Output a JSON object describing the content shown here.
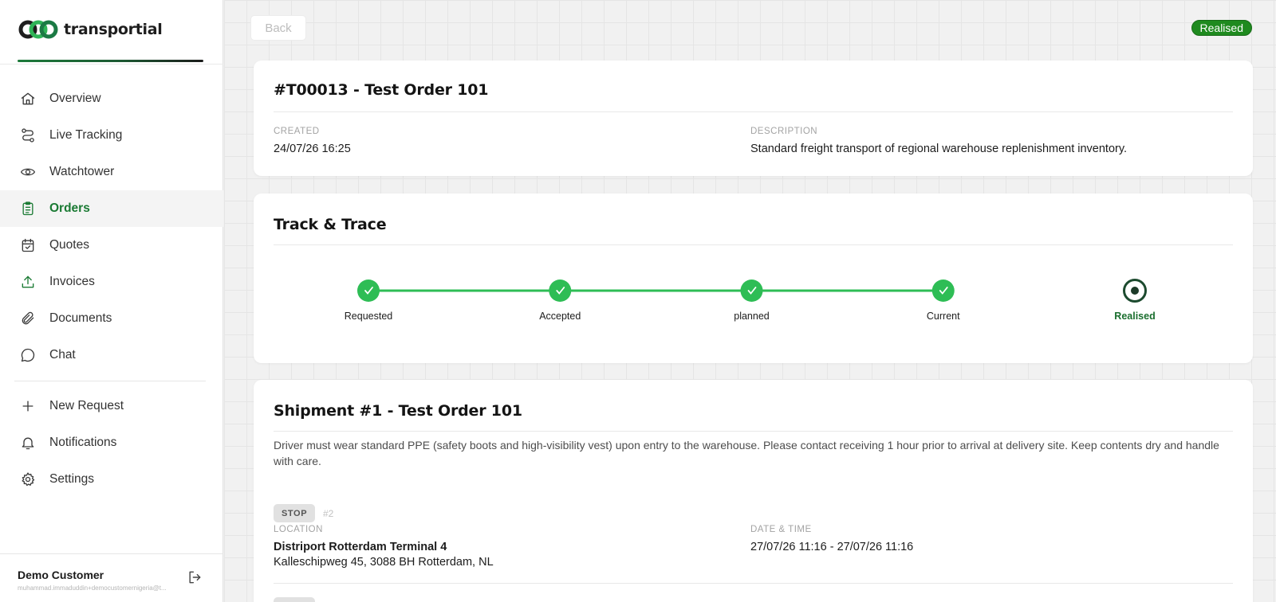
{
  "app": {
    "name": "transportial"
  },
  "sidebar": {
    "items": [
      {
        "label": "Overview",
        "icon": "home-icon"
      },
      {
        "label": "Live Tracking",
        "icon": "route-icon"
      },
      {
        "label": "Watchtower",
        "icon": "eye-icon"
      },
      {
        "label": "Orders",
        "icon": "clipboard-icon",
        "active": true
      },
      {
        "label": "Quotes",
        "icon": "calendar-check-icon"
      },
      {
        "label": "Invoices",
        "icon": "upload-icon"
      },
      {
        "label": "Documents",
        "icon": "paperclip-icon"
      },
      {
        "label": "Chat",
        "icon": "chat-bubble-icon"
      }
    ],
    "secondary": [
      {
        "label": "New Request",
        "icon": "plus-icon"
      },
      {
        "label": "Notifications",
        "icon": "bell-icon"
      },
      {
        "label": "Settings",
        "icon": "gear-icon"
      }
    ],
    "user": {
      "name": "Demo Customer",
      "email": "muhammad.immaduddin+democustomernigeria@t..."
    }
  },
  "header": {
    "back_label": "Back",
    "status": "Realised"
  },
  "order": {
    "title": "#T00013 - Test Order 101",
    "created_label": "CREATED",
    "created_value": "24/07/26 16:25",
    "description_label": "DESCRIPTION",
    "description_value": "Standard freight transport of regional warehouse replenishment inventory."
  },
  "track": {
    "title": "Track & Trace",
    "steps": [
      "Requested",
      "Accepted",
      "planned",
      "Current",
      "Realised"
    ],
    "current_index": 4
  },
  "shipment": {
    "title": "Shipment #1 - Test Order 101",
    "instructions": "Driver must wear standard PPE (safety boots and high-visibility vest) upon entry to the warehouse. Please contact receiving 1 hour prior to arrival at delivery site. Keep contents dry and handle with care.",
    "stop_chip": "STOP",
    "stop_number": "#2",
    "location_label": "LOCATION",
    "location_name": "Distriport Rotterdam Terminal 4",
    "location_address": "Kalleschipweg 45, 3088 BH Rotterdam, NL",
    "datetime_label": "DATE & TIME",
    "datetime_value": "27/07/26 11:16 - 27/07/26 11:16"
  },
  "colors": {
    "accent": "#1a7a33",
    "progress_green": "#2ebd55",
    "status_pill": "#1f8a1f"
  }
}
